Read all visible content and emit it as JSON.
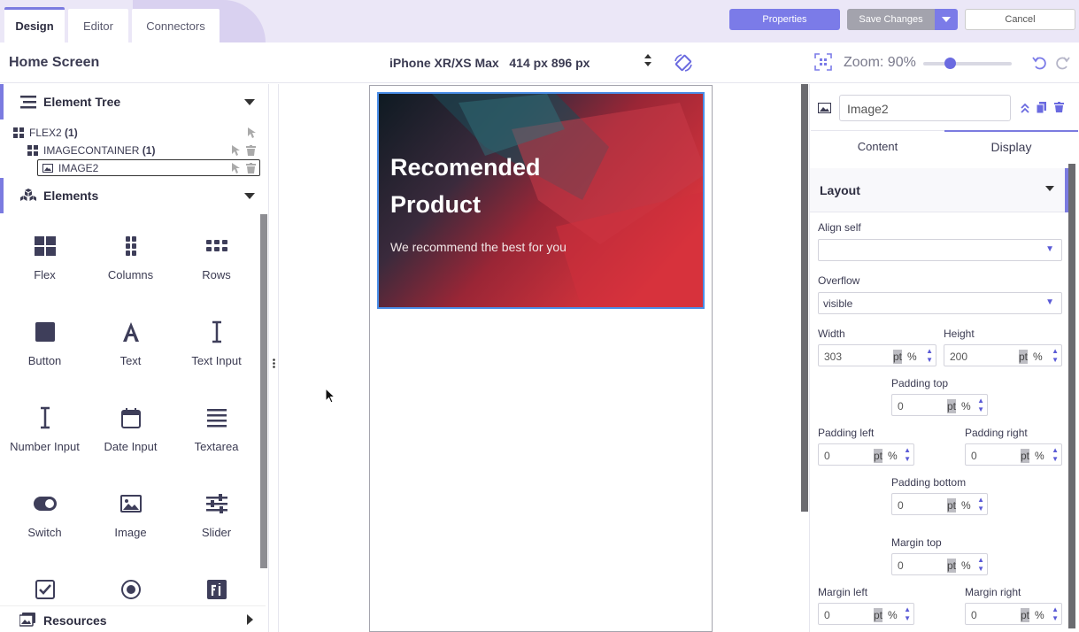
{
  "tabs": [
    {
      "label": "Design",
      "active": true
    },
    {
      "label": "Editor",
      "active": false
    },
    {
      "label": "Connectors",
      "active": false
    }
  ],
  "header_buttons": {
    "properties": "Properties",
    "save": "Save Changes",
    "cancel": "Cancel"
  },
  "toolbar": {
    "screen_title": "Home Screen",
    "device": "iPhone XR/XS Max   414 px 896 px",
    "zoom_label": "Zoom: 90%",
    "zoom_fraction": 0.3
  },
  "element_tree": {
    "title": "Element Tree",
    "nodes": [
      {
        "label": "FLEX2",
        "count": "(1)"
      },
      {
        "label": "IMAGECONTAINER",
        "count": "(1)"
      },
      {
        "label": "IMAGE2",
        "count": ""
      }
    ]
  },
  "elements": {
    "title": "Elements",
    "items": [
      {
        "label": "Flex",
        "icon": "flex-icon"
      },
      {
        "label": "Columns",
        "icon": "columns-icon"
      },
      {
        "label": "Rows",
        "icon": "rows-icon"
      },
      {
        "label": "Button",
        "icon": "button-icon"
      },
      {
        "label": "Text",
        "icon": "text-icon"
      },
      {
        "label": "Text Input",
        "icon": "text-input-icon"
      },
      {
        "label": "Number Input",
        "icon": "number-input-icon"
      },
      {
        "label": "Date Input",
        "icon": "calendar-icon"
      },
      {
        "label": "Textarea",
        "icon": "textarea-icon"
      },
      {
        "label": "Switch",
        "icon": "switch-icon"
      },
      {
        "label": "Image",
        "icon": "image-icon"
      },
      {
        "label": "Slider",
        "icon": "slider-icon"
      }
    ]
  },
  "resources": {
    "title": "Resources"
  },
  "canvas": {
    "hero_title": "Recomended Product",
    "hero_subtitle": "We recommend the best for you"
  },
  "properties_panel": {
    "element_name": "Image2",
    "tabs": [
      {
        "label": "Content",
        "active": false
      },
      {
        "label": "Display",
        "active": true
      }
    ],
    "layout_title": "Layout",
    "align_self_label": "Align self",
    "align_self_value": "",
    "overflow_label": "Overflow",
    "overflow_value": "visible",
    "width_label": "Width",
    "width_value": "303",
    "height_label": "Height",
    "height_value": "200",
    "padding_top_label": "Padding top",
    "padding_top_value": "0",
    "padding_left_label": "Padding left",
    "padding_left_value": "0",
    "padding_right_label": "Padding right",
    "padding_right_value": "0",
    "padding_bottom_label": "Padding bottom",
    "padding_bottom_value": "0",
    "margin_top_label": "Margin top",
    "margin_top_value": "0",
    "margin_left_label": "Margin left",
    "margin_left_value": "0",
    "margin_right_label": "Margin right",
    "margin_right_value": "0",
    "unit_pt": "pt",
    "unit_pct": "%"
  },
  "colors": {
    "accent": "#7b7be8",
    "selection_border": "#4a8ee8"
  }
}
